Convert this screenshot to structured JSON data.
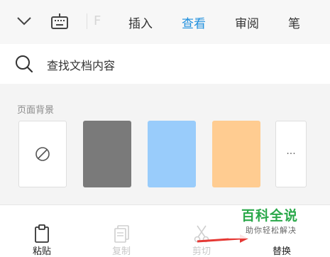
{
  "toolbar": {
    "tabs": [
      {
        "label": "插入",
        "active": false
      },
      {
        "label": "查看",
        "active": true
      },
      {
        "label": "审阅",
        "active": false
      },
      {
        "label": "笔",
        "active": false
      }
    ],
    "ghost_tab": "F",
    "icons": [
      "chevron-down-icon",
      "keyboard-icon"
    ]
  },
  "search": {
    "placeholder": "查找文档内容"
  },
  "page_background": {
    "title": "页面背景",
    "swatches": [
      {
        "name": "none",
        "color": "#ffffff"
      },
      {
        "name": "gray",
        "color": "#7a7a7a"
      },
      {
        "name": "blue",
        "color": "#99ccfb"
      },
      {
        "name": "orange",
        "color": "#ffcc91"
      }
    ],
    "more_label": "···"
  },
  "bottom_bar": {
    "items": [
      {
        "label": "粘贴",
        "enabled": true
      },
      {
        "label": "复制",
        "enabled": false
      },
      {
        "label": "剪切",
        "enabled": false
      },
      {
        "label": "替换",
        "enabled": true
      }
    ]
  },
  "watermark": {
    "title": "百科全说",
    "subtitle": "助你轻松解决"
  },
  "colors": {
    "accent": "#1f8fdd",
    "watermark_green": "#2aa84a",
    "arrow_red": "#e53935"
  }
}
